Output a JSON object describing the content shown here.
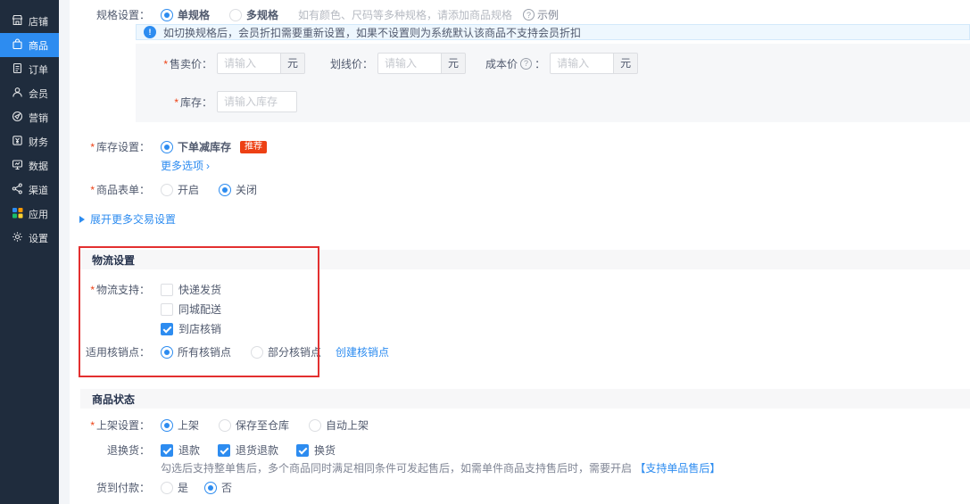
{
  "ui": {
    "required_mark": "*",
    "more_arrow": "›"
  },
  "colors": {
    "primary": "#2d8cf0",
    "sidebar_bg": "#1f2c3d",
    "danger": "#ed4014",
    "annotation_red": "#e33030"
  },
  "sidebar": {
    "items": [
      {
        "label": "店铺",
        "icon": "shop",
        "active": false
      },
      {
        "label": "商品",
        "icon": "goods",
        "active": true
      },
      {
        "label": "订单",
        "icon": "order",
        "active": false
      },
      {
        "label": "会员",
        "icon": "member",
        "active": false
      },
      {
        "label": "营销",
        "icon": "marketing",
        "active": false
      },
      {
        "label": "财务",
        "icon": "finance",
        "active": false
      },
      {
        "label": "数据",
        "icon": "data",
        "active": false
      },
      {
        "label": "渠道",
        "icon": "channel",
        "active": false
      },
      {
        "label": "应用",
        "icon": "apps",
        "active": false
      },
      {
        "label": "设置",
        "icon": "settings",
        "active": false
      }
    ]
  },
  "spec_row": {
    "label": "规格设置：",
    "options": [
      {
        "label": "单规格",
        "selected": true
      },
      {
        "label": "多规格",
        "selected": false
      }
    ],
    "hint": "如有颜色、尺码等多种规格，请添加商品规格",
    "example_label": "示例",
    "question_mark": "?"
  },
  "alert": {
    "icon_mark": "!",
    "text": "如切换规格后，会员折扣需要重新设置，如果不设置则为系统默认该商品不支持会员折扣"
  },
  "price_box": {
    "sale": {
      "label": "售卖价：",
      "placeholder": "请输入",
      "unit": "元"
    },
    "line": {
      "label": "划线价：",
      "placeholder": "请输入",
      "unit": "元"
    },
    "cost": {
      "label": "成本价",
      "colon": "：",
      "placeholder": "请输入",
      "unit": "元",
      "question_mark": "?"
    },
    "stock": {
      "label": "库存：",
      "placeholder": "请输入库存"
    }
  },
  "stock_setting": {
    "label": "库存设置：",
    "option": {
      "label": "下单减库存",
      "selected": true
    },
    "badge": "推荐",
    "more_link": "更多选项"
  },
  "product_form": {
    "label": "商品表单：",
    "options": [
      {
        "label": "开启",
        "selected": false
      },
      {
        "label": "关闭",
        "selected": true
      }
    ]
  },
  "expand_link": "展开更多交易设置",
  "logistics": {
    "title": "物流设置",
    "support_label": "物流支持：",
    "options": [
      {
        "label": "快递发货",
        "checked": false
      },
      {
        "label": "同城配送",
        "checked": false
      },
      {
        "label": "到店核销",
        "checked": true
      }
    ],
    "point_label": "适用核销点：",
    "point_options": [
      {
        "label": "所有核销点",
        "selected": true
      },
      {
        "label": "部分核销点",
        "selected": false
      }
    ],
    "create_link": "创建核销点"
  },
  "status": {
    "title": "商品状态",
    "shelf_label": "上架设置：",
    "shelf_options": [
      {
        "label": "上架",
        "selected": true
      },
      {
        "label": "保存至仓库",
        "selected": false
      },
      {
        "label": "自动上架",
        "selected": false
      }
    ],
    "returns_label": "退换货：",
    "returns_options": [
      {
        "label": "退款",
        "checked": true
      },
      {
        "label": "退货退款",
        "checked": true
      },
      {
        "label": "换货",
        "checked": true
      }
    ],
    "returns_help": "勾选后支持整单售后，多个商品同时满足相同条件可发起售后，如需单件商品支持售后时，需要开启",
    "returns_help_link": "【支持单品售后】",
    "cod_label": "货到付款：",
    "cod_options": [
      {
        "label": "是",
        "selected": false
      },
      {
        "label": "否",
        "selected": true
      }
    ]
  }
}
